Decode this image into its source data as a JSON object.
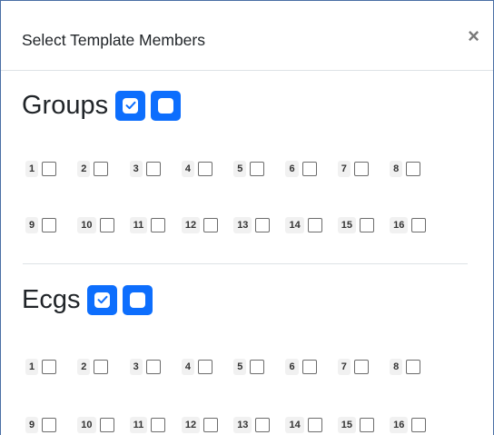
{
  "modal": {
    "title": "Select Template Members",
    "close_label": "×"
  },
  "sections": [
    {
      "title": "Groups",
      "select_all_label": "check-all",
      "deselect_all_label": "uncheck-all",
      "rows": [
        [
          "1",
          "2",
          "3",
          "4",
          "5",
          "6",
          "7",
          "8"
        ],
        [
          "9",
          "10",
          "11",
          "12",
          "13",
          "14",
          "15",
          "16"
        ]
      ]
    },
    {
      "title": "Ecgs",
      "select_all_label": "check-all",
      "deselect_all_label": "uncheck-all",
      "rows": [
        [
          "1",
          "2",
          "3",
          "4",
          "5",
          "6",
          "7",
          "8"
        ],
        [
          "9",
          "10",
          "11",
          "12",
          "13",
          "14",
          "15",
          "16"
        ]
      ]
    }
  ],
  "colors": {
    "accent": "#0d6efd",
    "border": "#4a6fa5",
    "divider": "#dee2e6"
  }
}
